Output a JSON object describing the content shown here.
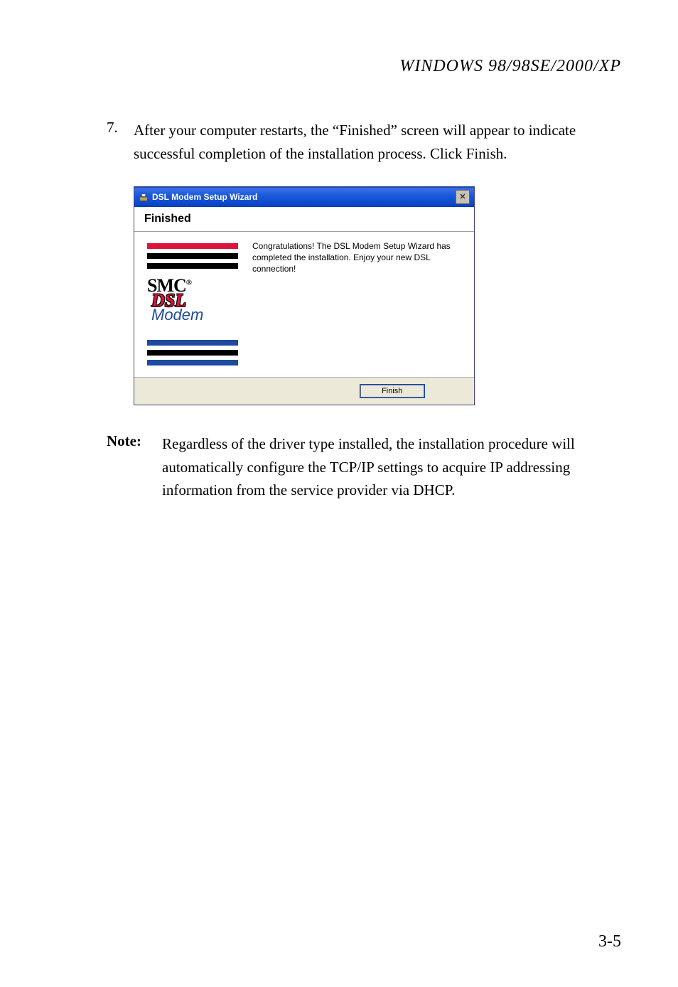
{
  "header": "WINDOWS 98/98SE/2000/XP",
  "step": {
    "num": "7.",
    "text": "After your computer restarts, the “Finished” screen will appear to indicate successful completion of the installation process. Click Finish."
  },
  "dialog": {
    "title": "DSL Modem Setup Wizard",
    "closeGlyph": "✕",
    "heading": "Finished",
    "body": "Congratulations!  The DSL Modem Setup Wizard has completed the installation.  Enjoy your new DSL connection!",
    "brand": {
      "line1": "SMC",
      "reg": "®",
      "line2": "DSL",
      "line3": "Modem"
    },
    "finishBtn": "Finish"
  },
  "note": {
    "label": "Note:",
    "text": "Regardless of the driver type installed, the installation procedure will automatically configure the TCP/IP settings to acquire IP addressing information from the service provider via DHCP."
  },
  "pageNum": "3-5"
}
